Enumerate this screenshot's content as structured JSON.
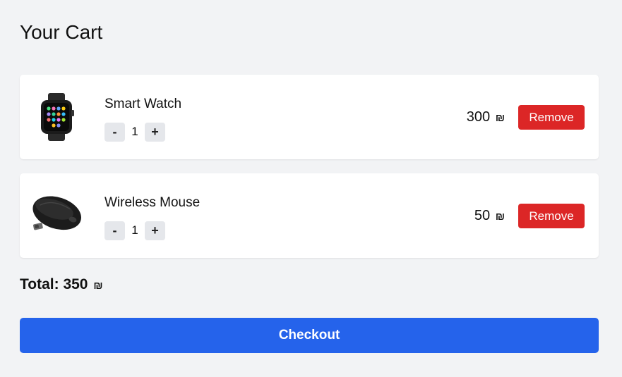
{
  "page": {
    "title": "Your Cart"
  },
  "cart": {
    "items": [
      {
        "name": "Smart Watch",
        "image_icon": "smart-watch-image",
        "quantity": "1",
        "decrement_label": "-",
        "increment_label": "+",
        "price": "300",
        "currency": "₪",
        "remove_label": "Remove"
      },
      {
        "name": "Wireless Mouse",
        "image_icon": "wireless-mouse-image",
        "quantity": "1",
        "decrement_label": "-",
        "increment_label": "+",
        "price": "50",
        "currency": "₪",
        "remove_label": "Remove"
      }
    ]
  },
  "summary": {
    "total_label": "Total:",
    "total_value": "350",
    "currency": "₪"
  },
  "checkout": {
    "label": "Checkout"
  },
  "colors": {
    "background": "#f2f3f5",
    "card": "#ffffff",
    "remove": "#dc2626",
    "checkout": "#2563eb",
    "qty_button": "#e5e7eb"
  }
}
